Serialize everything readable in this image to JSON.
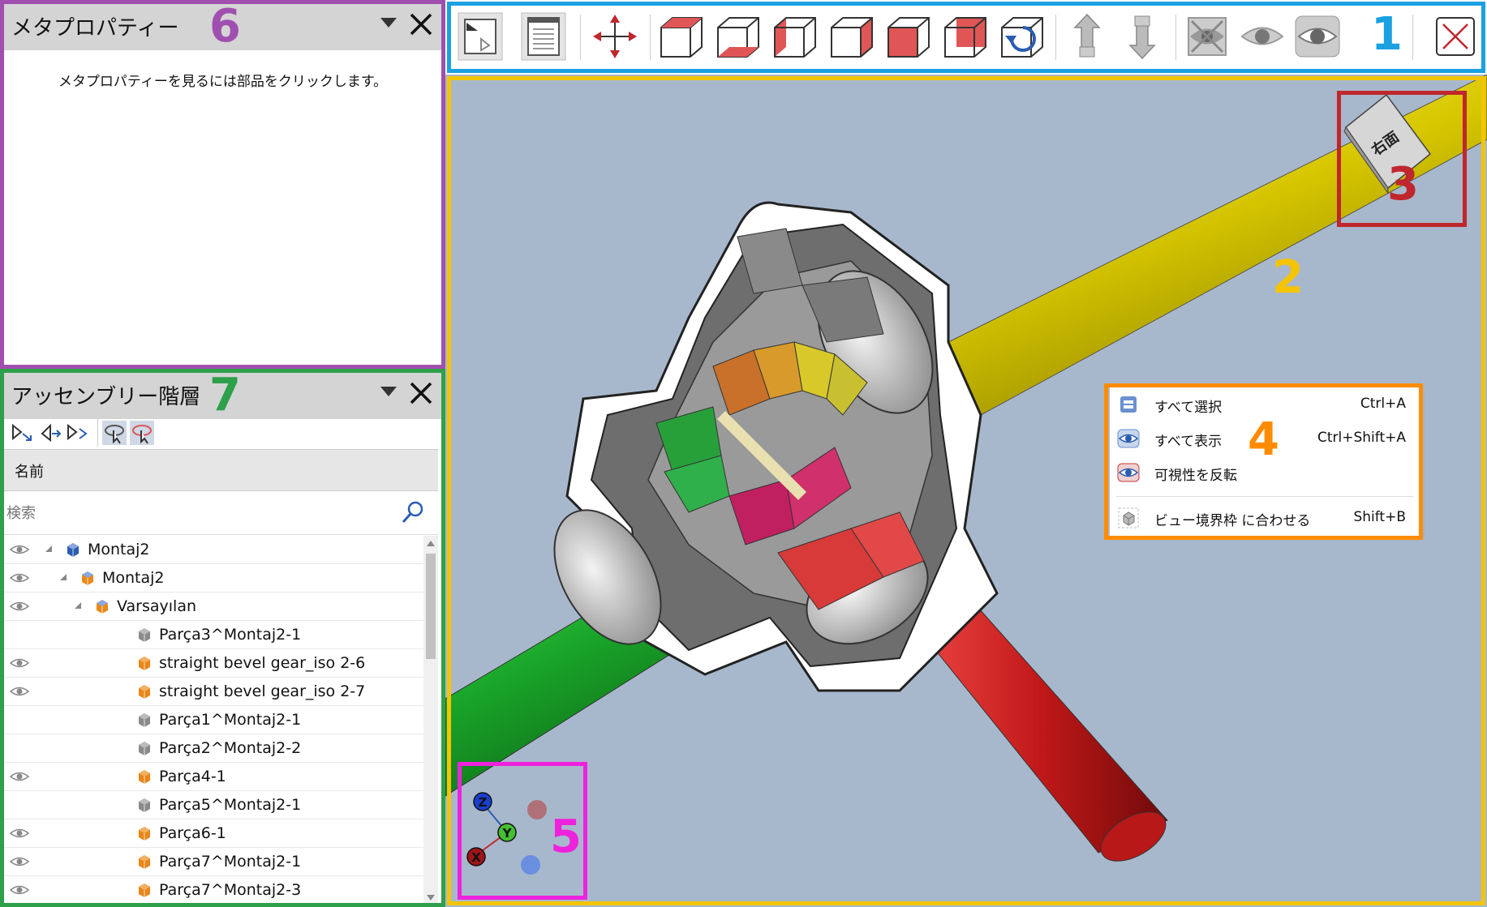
{
  "meta_panel": {
    "title": "メタプロパティー",
    "message": "メタプロパティーを見るには部品をクリックします。"
  },
  "assembly_panel": {
    "title": "アッセンブリー階層",
    "column_name": "名前",
    "search_placeholder": "検索",
    "rows": [
      {
        "label": "Montaj2",
        "visible": true,
        "depth": 0,
        "icon": "assembly-icon"
      },
      {
        "label": "Montaj2",
        "visible": true,
        "depth": 1,
        "icon": "subassembly-icon"
      },
      {
        "label": "Varsayılan",
        "visible": true,
        "depth": 2,
        "icon": "subassembly-icon"
      },
      {
        "label": "Parça3^Montaj2-1",
        "visible": false,
        "depth": 3,
        "icon": "part-gray-icon"
      },
      {
        "label": "straight bevel gear_iso 2-6",
        "visible": true,
        "depth": 3,
        "icon": "part-orange-icon"
      },
      {
        "label": "straight bevel gear_iso 2-7",
        "visible": true,
        "depth": 3,
        "icon": "part-orange-icon"
      },
      {
        "label": "Parça1^Montaj2-1",
        "visible": false,
        "depth": 3,
        "icon": "part-gray-icon"
      },
      {
        "label": "Parça2^Montaj2-2",
        "visible": false,
        "depth": 3,
        "icon": "part-gray-icon"
      },
      {
        "label": "Parça4-1",
        "visible": true,
        "depth": 3,
        "icon": "part-orange-icon"
      },
      {
        "label": "Parça5^Montaj2-1",
        "visible": false,
        "depth": 3,
        "icon": "part-gray-icon"
      },
      {
        "label": "Parça6-1",
        "visible": true,
        "depth": 3,
        "icon": "part-orange-icon"
      },
      {
        "label": "Parça7^Montaj2-1",
        "visible": true,
        "depth": 3,
        "icon": "part-orange-icon"
      },
      {
        "label": "Parça7^Montaj2-3",
        "visible": true,
        "depth": 3,
        "icon": "part-orange-icon"
      }
    ]
  },
  "toolbar": {
    "icons": [
      "panel-toggle-icon",
      "document-icon",
      "fit-view-icon",
      "front-view-icon",
      "bottom-view-icon",
      "left-view-icon",
      "right-view-icon",
      "back-view-icon",
      "top-view-icon",
      "rotate-view-icon",
      "move-up-icon",
      "move-down-icon",
      "hide-selected-icon",
      "show-icon",
      "show-all-icon",
      "close-icon"
    ]
  },
  "view_cube": {
    "label": "右面"
  },
  "context_menu": {
    "items": [
      {
        "label": "すべて選択",
        "shortcut": "Ctrl+A",
        "icon": "select-all-icon"
      },
      {
        "label": "すべて表示",
        "shortcut": "Ctrl+Shift+A",
        "icon": "show-all-icon"
      },
      {
        "label": "可視性を反転",
        "shortcut": "",
        "icon": "invert-visibility-icon"
      },
      {
        "label": "ビュー境界枠 に合わせる",
        "shortcut": "Shift+B",
        "icon": "fit-bounds-icon"
      }
    ]
  },
  "triad": {
    "x": "X",
    "y": "Y",
    "z": "Z"
  },
  "annotations": [
    "1",
    "2",
    "3",
    "4",
    "5",
    "6",
    "7"
  ],
  "colors": {
    "annot_toolbar": "#1ba1e2",
    "annot_viewport": "#f5c400",
    "annot_viewcube": "#c0262d",
    "annot_menu": "#ff8c00",
    "annot_triad": "#ee22dd",
    "annot_meta": "#a04fb0",
    "annot_assembly": "#2ea04a",
    "viewport_bg": "#a8b8cc"
  }
}
